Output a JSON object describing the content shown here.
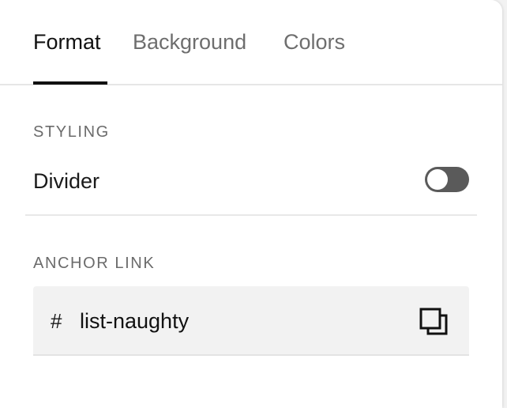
{
  "tabs": {
    "format": "Format",
    "background": "Background",
    "colors": "Colors",
    "active": "format"
  },
  "styling": {
    "section_title": "STYLING",
    "divider_label": "Divider",
    "divider_enabled": false
  },
  "anchor_link": {
    "section_title": "ANCHOR LINK",
    "prefix": "#",
    "value": "list-naughty",
    "copy_icon": "copy-icon"
  },
  "colors": {
    "panel_bg": "#ffffff",
    "page_bg": "#f2f2f2",
    "active_text": "#111111",
    "inactive_text": "#6e6e6e",
    "toggle_off": "#5a5a5a",
    "field_bg": "#f2f2f2"
  }
}
